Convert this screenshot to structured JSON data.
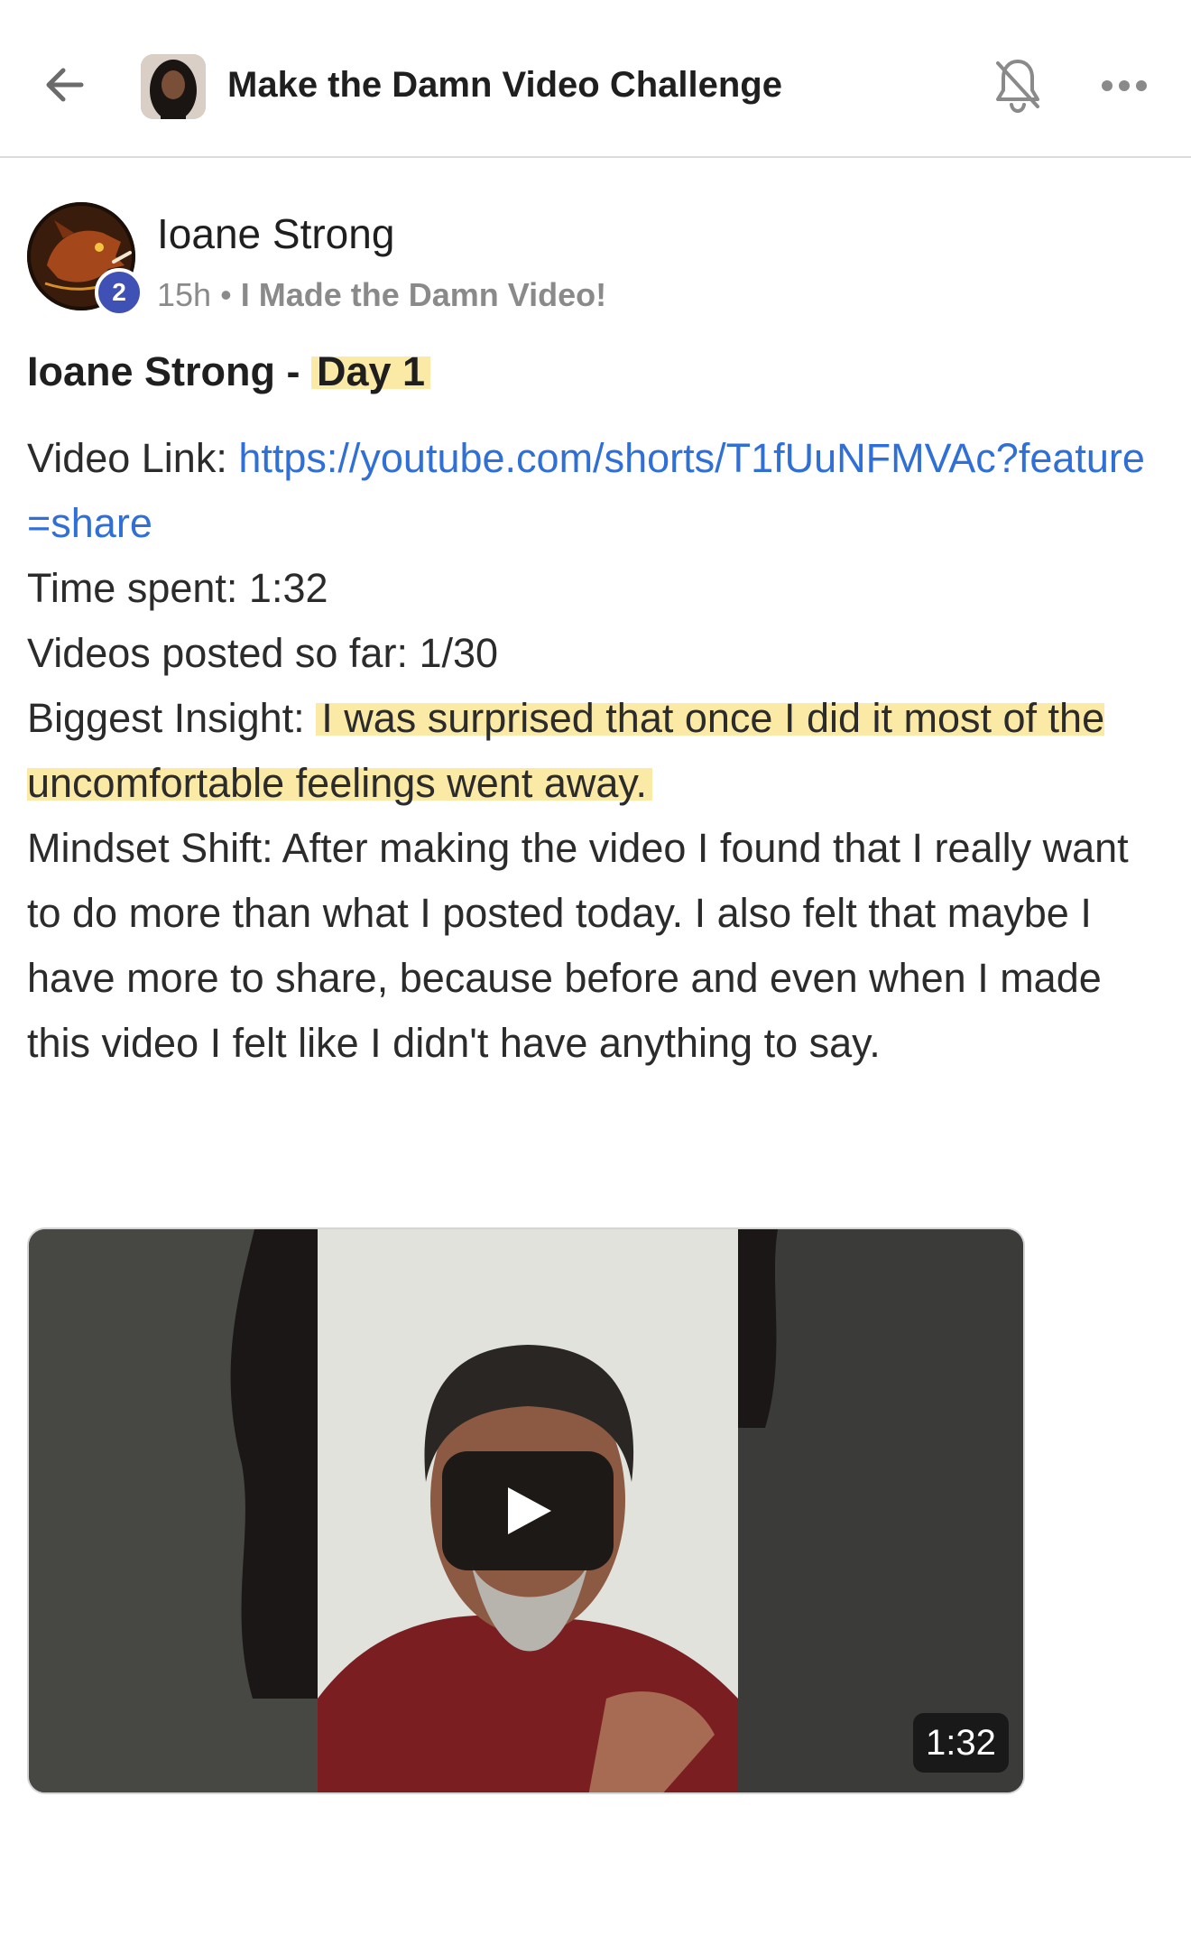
{
  "header": {
    "title": "Make the Damn Video Challenge",
    "icons": [
      "arrow-left-icon",
      "bell-icon",
      "more-horizontal-icon"
    ]
  },
  "post": {
    "author": "Ioane Strong",
    "level": "2",
    "time": "15h",
    "separator": "•",
    "category": "I Made the Damn Video!",
    "title_prefix": "Ioane Strong - ",
    "title_highlight": "Day 1",
    "video_link_label": "Video Link: ",
    "video_link_url": "https://youtube.com/shorts/T1fUuNFMVAc?feature=share",
    "time_spent": "Time spent: 1:32",
    "videos_posted": "Videos posted so far: 1/30",
    "insight_label": "Biggest Insight: ",
    "insight_text": "I was surprised that once I did it most of the uncomfortable feelings went away.",
    "mindset_shift": "Mindset Shift: After making the video I found that I really want to do more than what I posted today. I also felt that maybe I have more to share, because before and even when I made this video I felt like I didn't have anything to say.",
    "highlight_color": "#fbeaa6",
    "link_color": "#2f6fd6"
  },
  "video": {
    "duration": "1:32"
  }
}
